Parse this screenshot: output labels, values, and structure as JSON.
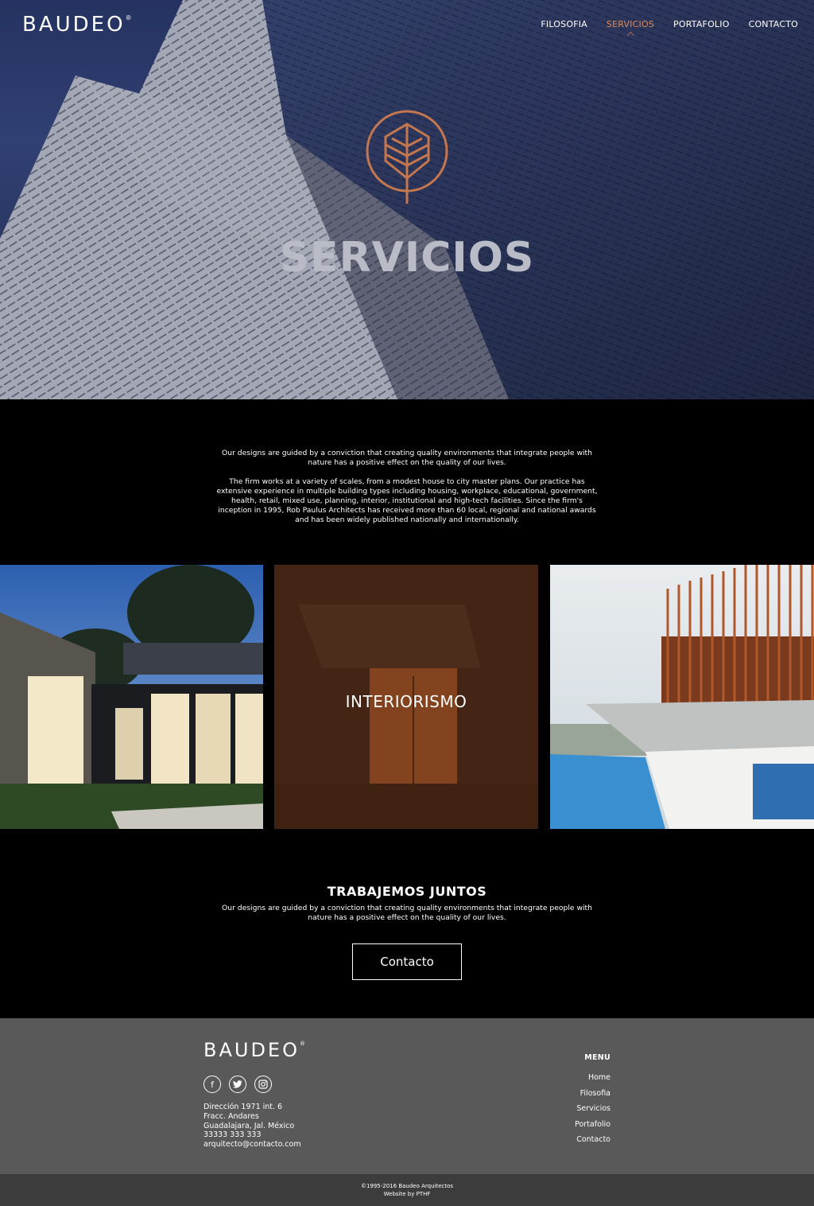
{
  "brand": {
    "name": "BAUDEO",
    "mark": "®"
  },
  "nav": {
    "items": [
      {
        "label": "FILOSOFIA",
        "active": false
      },
      {
        "label": "SERVICIOS",
        "active": true
      },
      {
        "label": "PORTAFOLIO",
        "active": false
      },
      {
        "label": "CONTACTO",
        "active": false
      }
    ]
  },
  "hero": {
    "title": "SERVICIOS",
    "emblem_icon": "leaf-emblem-icon"
  },
  "intro": {
    "paragraphs": [
      "Our designs are guided by a conviction that creating quality environments that integrate people with nature has a positive effect on the quality of our lives.",
      "The firm works at a variety of scales, from a modest house to city master plans. Our practice has extensive experience in multiple building types including housing, workplace, educational, government, health, retail, mixed use, planning, interior, institutional and high-tech facilities. Since the firm's inception in 1995, Rob Paulus Architects has received more than 60 local, regional and national awards and has been widely published nationally and internationally."
    ]
  },
  "tiles": [
    {
      "label": ""
    },
    {
      "label": "INTERIORISMO"
    },
    {
      "label": ""
    }
  ],
  "cta": {
    "title": "TRABAJEMOS JUNTOS",
    "text": "Our designs are guided by a conviction that creating quality environments that integrate people with nature has a positive effect on the quality of our lives.",
    "button": "Contacto"
  },
  "footer": {
    "logo": "BAUDEO",
    "logo_mark": "®",
    "socials": [
      "facebook-icon",
      "twitter-icon",
      "instagram-icon"
    ],
    "address": [
      "Dirección 1971 int. 6",
      "Fracc. Andares",
      "Guadalajara, Jal. México",
      "33333 333 333",
      "arquitecto@contacto.com"
    ],
    "menu_title": "MENU",
    "menu": [
      "Home",
      "Filosofia",
      "Servicios",
      "Portafolio",
      "Contacto"
    ]
  },
  "bottom": {
    "copyright": "©1995-2016 Baudeo Arquitectos",
    "credit": "Website by PTHF"
  },
  "colors": {
    "accent": "#e0895a",
    "footer_bg": "#595959",
    "bottom_bg": "#3c3c3c",
    "page_bg": "#000000"
  }
}
